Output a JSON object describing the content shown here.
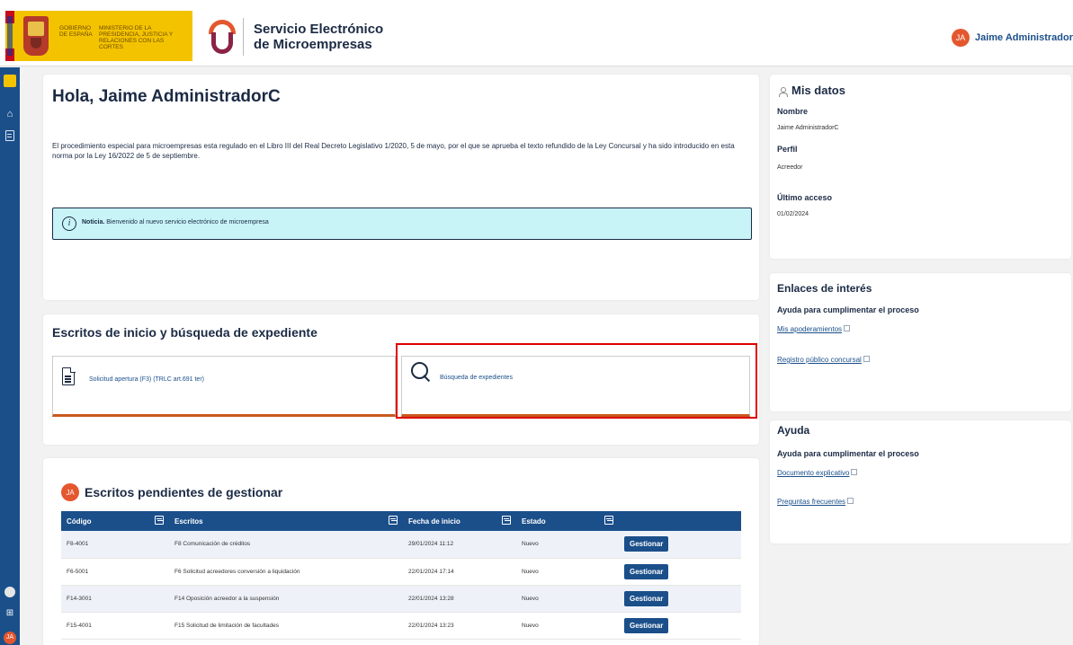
{
  "header": {
    "gov_text": "GOBIERNO DE ESPAÑA",
    "ministry_text": "MINISTERIO DE LA PRESIDENCIA, JUSTICIA Y RELACIONES CON LAS CORTES",
    "brand_title_line1": "Servicio Electrónico",
    "brand_title_line2": "de Microempresas",
    "user_initials": "JA",
    "user_name": "Jaime Administrador"
  },
  "sidebar": {
    "user_initials": "JA"
  },
  "greeting": {
    "title": "Hola, Jaime AdministradorC",
    "body": "El procedimiento especial para microempresas esta regulado en el Libro III del Real Decreto Legislativo 1/2020, 5 de mayo, por el que se aprueba el texto refundido de la Ley Concursal y ha sido introducido en esta norma por la Ley 16/2022 de 5 de septiembre.",
    "notice_label": "Noticia.",
    "notice_text": "Bienvenido al nuevo servicio electrónico de microempresa"
  },
  "escritos": {
    "title": "Escritos de inicio y búsqueda de expediente",
    "tile1_label": "Solicitud apertura (F3) (TRLC art.691 ter)",
    "tile2_label": "Búsqueda de expedientes"
  },
  "pendientes": {
    "avatar": "JA",
    "title": "Escritos pendientes de gestionar",
    "columns": [
      "Código",
      "Escritos",
      "Fecha de inicio",
      "Estado"
    ],
    "rows": [
      {
        "codigo": "F8-4001",
        "escrito": "F8 Comunicación de créditos",
        "fecha": "29/01/2024 11:12",
        "estado": "Nuevo",
        "accion": "Gestionar"
      },
      {
        "codigo": "F6-5001",
        "escrito": "F6 Solicitud acreedores conversión a liquidación",
        "fecha": "22/01/2024 17:14",
        "estado": "Nuevo",
        "accion": "Gestionar"
      },
      {
        "codigo": "F14-3001",
        "escrito": "F14 Oposición acreedor a la suspensión",
        "fecha": "22/01/2024 13:28",
        "estado": "Nuevo",
        "accion": "Gestionar"
      },
      {
        "codigo": "F15-4001",
        "escrito": "F15 Solicitud de limitación de facultades",
        "fecha": "22/01/2024 13:23",
        "estado": "Nuevo",
        "accion": "Gestionar"
      }
    ]
  },
  "mis_datos": {
    "title": "Mis datos",
    "nombre_label": "Nombre",
    "nombre_value": "Jaime AdministradorC",
    "perfil_label": "Perfil",
    "perfil_value": "Acreedor",
    "acceso_label": "Último acceso",
    "acceso_value": "01/02/2024"
  },
  "enlaces": {
    "title": "Enlaces de interés",
    "subtitle": "Ayuda para cumplimentar el proceso",
    "link1": "Mis apoderamientos",
    "link2": "Registro público concursal"
  },
  "ayuda": {
    "title": "Ayuda",
    "subtitle": "Ayuda para cumplimentar el proceso",
    "link1": "Documento explicativo",
    "link2": "Preguntas frecuentes"
  },
  "colors": {
    "primary": "#1b4f8a",
    "accent": "#e4572e",
    "notice_bg": "#c8f4f8",
    "highlight": "#e00000"
  }
}
